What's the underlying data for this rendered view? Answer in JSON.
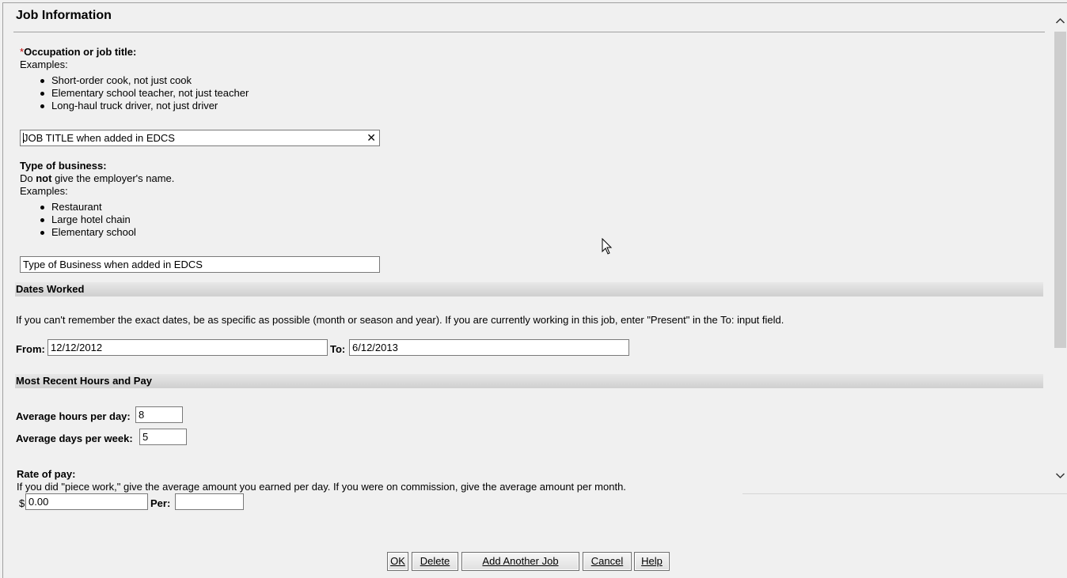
{
  "header": {
    "title": "Job Information"
  },
  "occupation": {
    "required_mark": "*",
    "label": "Occupation or job title:",
    "examples_label": "Examples:",
    "examples": [
      "Short-order cook, not just cook",
      "Elementary school teacher, not just teacher",
      "Long-haul truck driver, not just driver"
    ],
    "value": "JOB TITLE when added in EDCS",
    "clear_glyph": "✕"
  },
  "business": {
    "label": "Type of business:",
    "note_prefix": "Do ",
    "note_bold": "not",
    "note_suffix": " give the employer's name.",
    "examples_label": "Examples:",
    "examples": [
      "Restaurant",
      "Large hotel chain",
      "Elementary school"
    ],
    "value": "Type of Business when added in EDCS"
  },
  "dates": {
    "section_title": "Dates Worked",
    "instructions": "If you can't remember the exact dates, be as specific as possible (month or season and year). If you are currently working in this job, enter \"Present\" in the To: input field.",
    "from_label": "From:",
    "from_value": "12/12/2012",
    "to_label": "To:",
    "to_value": "6/12/2013"
  },
  "hours": {
    "section_title": "Most Recent Hours and Pay",
    "hours_label": "Average hours per day:",
    "hours_value": "8",
    "days_label": "Average days per week:",
    "days_value": "5",
    "rate_label": "Rate of pay:",
    "rate_note": "If you did \"piece work,\" give the average amount you earned per day. If you were on commission, give the average amount per month.",
    "currency": "$",
    "rate_value": "0.00",
    "per_label": "Per:",
    "per_selected": ""
  },
  "buttons": {
    "ok": "OK",
    "delete": "Delete",
    "add_another": "Add Another Job",
    "cancel": "Cancel",
    "help": "Help"
  },
  "icons": {
    "scroll_up": "chevron-up-icon",
    "scroll_down": "chevron-down-icon",
    "dropdown": "chevron-down-icon",
    "clear": "close-icon"
  },
  "colors": {
    "background": "#f0f0f0",
    "required": "#c00000",
    "section_bar": "#d8d8d8"
  }
}
